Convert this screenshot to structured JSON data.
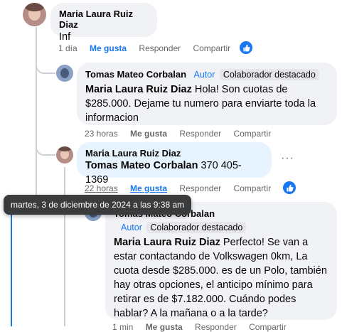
{
  "comments": [
    {
      "author": "Maria Laura Ruiz Diaz",
      "text": "Inf",
      "time": "1 día",
      "like_label": "Me gusta",
      "reply_label": "Responder",
      "share_label": "Compartir"
    },
    {
      "author": "Tomas Mateo Corbalan",
      "author_tag": "Autor",
      "badge": "Colaborador destacado",
      "mention": "Maria Laura Ruiz Diaz",
      "text": " Hola! Son cuotas de $285.000. Dejame tu numero para enviarte toda la informacion",
      "time": "23 horas",
      "like_label": "Me gusta",
      "reply_label": "Responder",
      "share_label": "Compartir"
    },
    {
      "author": "Maria Laura Ruiz Diaz",
      "mention": "Tomas Mateo Corbalan",
      "text": " 370 405-1369",
      "time": "22 horas",
      "like_label": "Me gusta",
      "reply_label": "Responder",
      "share_label": "Compartir",
      "more": "···"
    },
    {
      "author": "Tomas Mateo Corbalan",
      "author_tag": "Autor",
      "badge": "Colaborador destacado",
      "mention": "Maria Laura Ruiz Diaz",
      "text": " Perfecto! Se van a estar contactando de Volkswagen 0km, La cuota desde $285.000. es de un Polo, también hay otras opciones, el anticipo mínimo para retirar es de $7.182.000. Cuándo podes hablar? A la mañana o a la tarde?",
      "time": "1 min",
      "like_label": "Me gusta",
      "reply_label": "Responder",
      "share_label": "Compartir"
    }
  ],
  "tooltip": "martes, 3 de diciembre de 2024 a las 9:38 am",
  "colors": {
    "accent": "#1877f2",
    "bubble": "#f0f2f5",
    "highlight": "#e7f3ff"
  }
}
